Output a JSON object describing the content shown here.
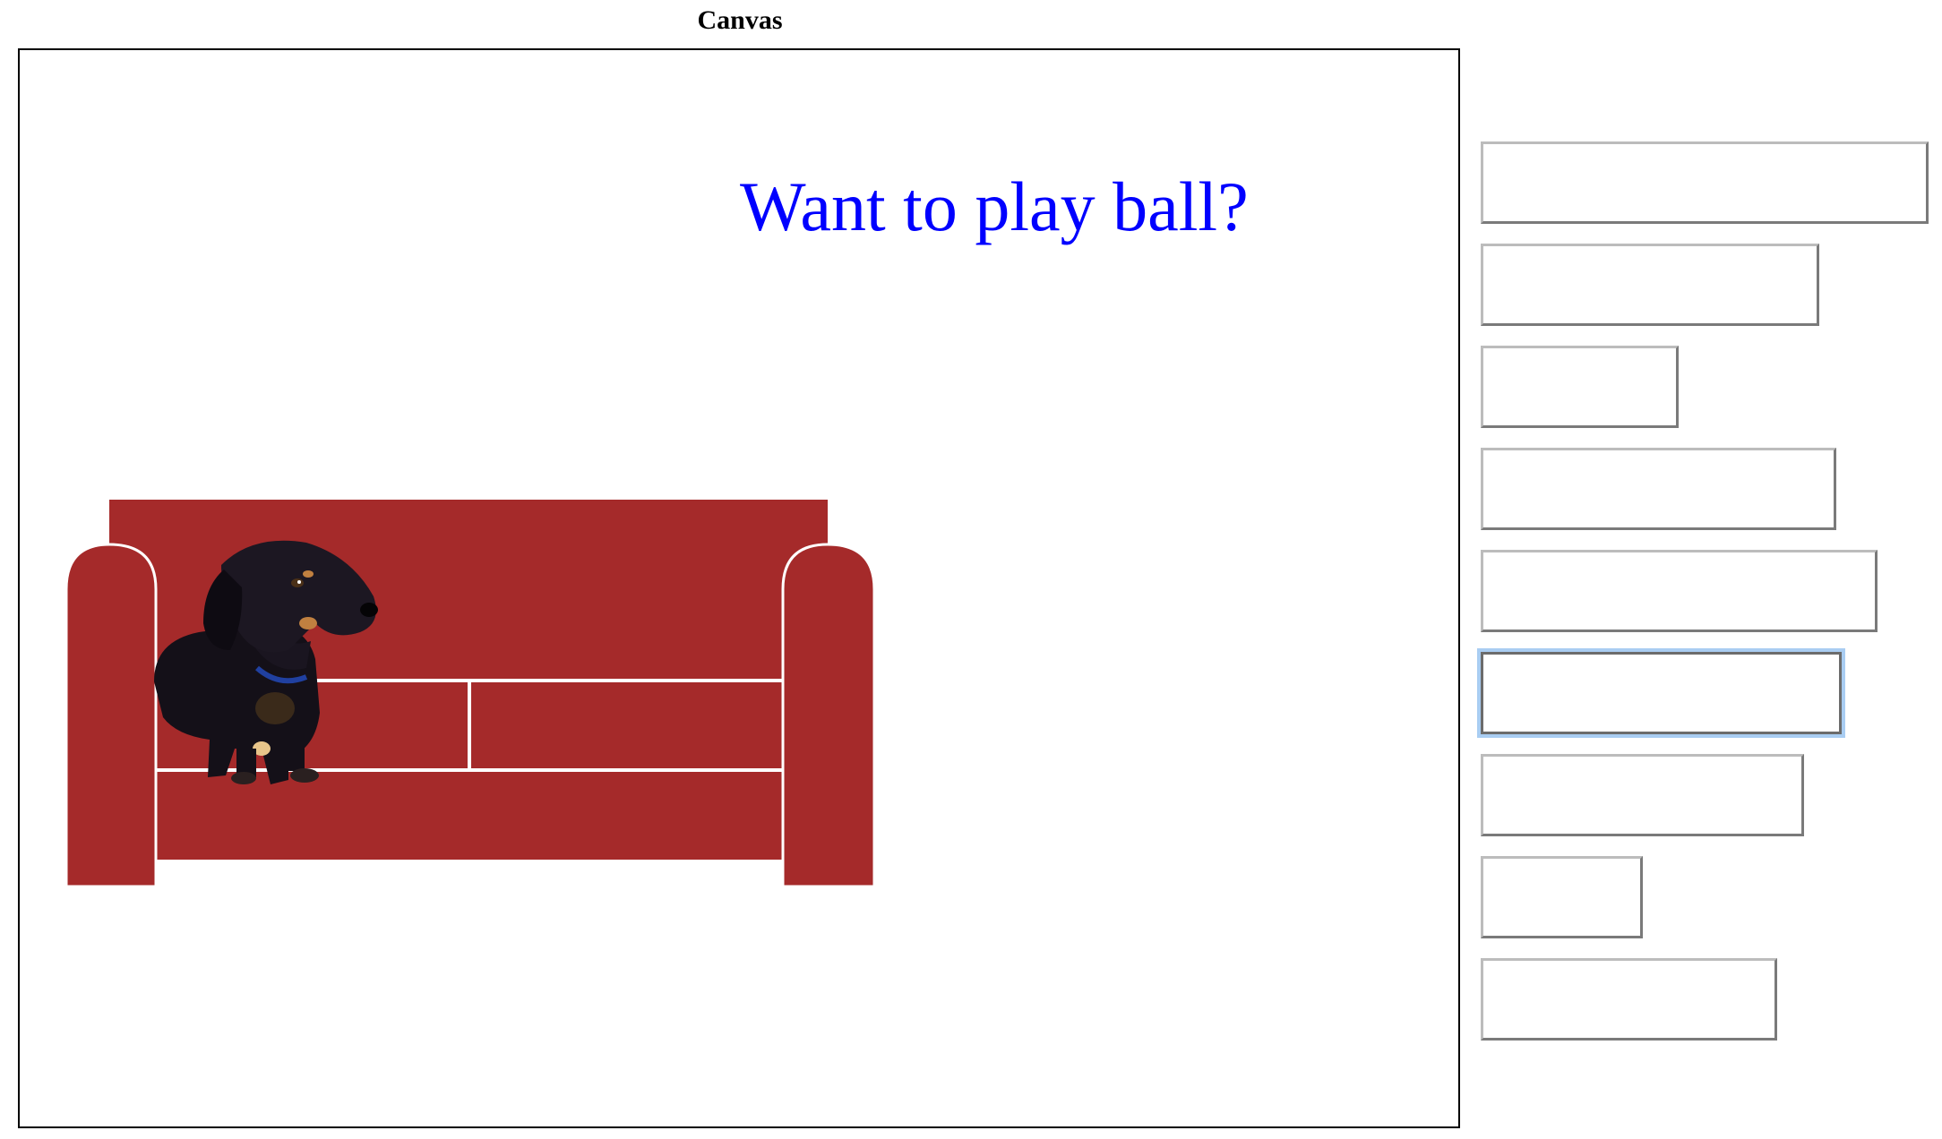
{
  "heading": "Canvas",
  "canvas": {
    "speech_text": "Want to play ball?",
    "speech_color": "#0000ff",
    "couch_color": "#a52a2a",
    "couch_seam_color": "#ffffff",
    "images": [
      "couch",
      "dachshund-dog"
    ]
  },
  "inputs": {
    "count": 9,
    "focused_index": 5,
    "fields": [
      {
        "value": "",
        "placeholder": ""
      },
      {
        "value": "",
        "placeholder": ""
      },
      {
        "value": "",
        "placeholder": ""
      },
      {
        "value": "",
        "placeholder": ""
      },
      {
        "value": "",
        "placeholder": ""
      },
      {
        "value": "",
        "placeholder": ""
      },
      {
        "value": "",
        "placeholder": ""
      },
      {
        "value": "",
        "placeholder": ""
      },
      {
        "value": "",
        "placeholder": ""
      }
    ]
  }
}
